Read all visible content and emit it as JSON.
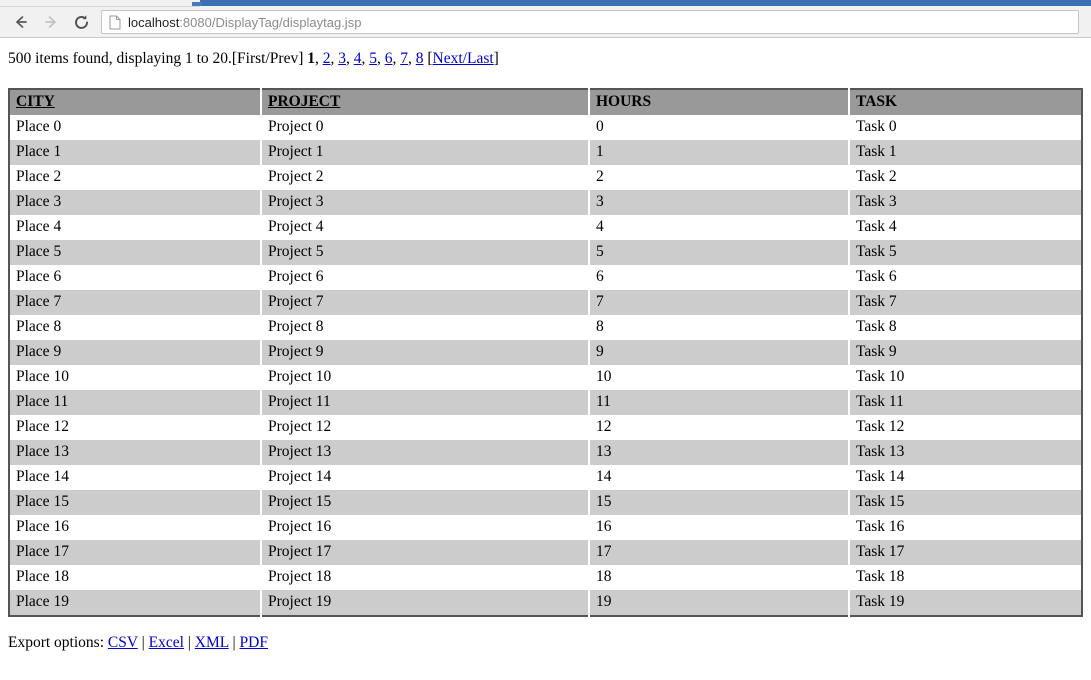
{
  "browser": {
    "back_label": "Back",
    "forward_label": "Forward",
    "reload_label": "Reload",
    "url_host": "localhost",
    "url_rest": ":8080/DisplayTag/displaytag.jsp",
    "url_full": "localhost:8080/DisplayTag/displaytag.jsp",
    "page_icon": "page-icon"
  },
  "pagination": {
    "summary": "500 items found, displaying 1 to 20.",
    "first_prev": "[First/Prev]",
    "current_page": "1",
    "comma": ", ",
    "pages": [
      "2",
      "3",
      "4",
      "5",
      "6",
      "7",
      "8"
    ],
    "next_last_open": "[",
    "next_label": "Next",
    "next_last_slash": "/",
    "last_label": "Last",
    "next_last_close": "]",
    "total_items": 500,
    "display_from": 1,
    "display_to": 20
  },
  "table": {
    "columns": [
      {
        "label": "CITY",
        "sortable": true
      },
      {
        "label": "PROJECT",
        "sortable": true
      },
      {
        "label": "HOURS",
        "sortable": false
      },
      {
        "label": "TASK",
        "sortable": false
      }
    ],
    "rows": [
      [
        "Place 0",
        "Project 0",
        "0",
        "Task 0"
      ],
      [
        "Place 1",
        "Project 1",
        "1",
        "Task 1"
      ],
      [
        "Place 2",
        "Project 2",
        "2",
        "Task 2"
      ],
      [
        "Place 3",
        "Project 3",
        "3",
        "Task 3"
      ],
      [
        "Place 4",
        "Project 4",
        "4",
        "Task 4"
      ],
      [
        "Place 5",
        "Project 5",
        "5",
        "Task 5"
      ],
      [
        "Place 6",
        "Project 6",
        "6",
        "Task 6"
      ],
      [
        "Place 7",
        "Project 7",
        "7",
        "Task 7"
      ],
      [
        "Place 8",
        "Project 8",
        "8",
        "Task 8"
      ],
      [
        "Place 9",
        "Project 9",
        "9",
        "Task 9"
      ],
      [
        "Place 10",
        "Project 10",
        "10",
        "Task 10"
      ],
      [
        "Place 11",
        "Project 11",
        "11",
        "Task 11"
      ],
      [
        "Place 12",
        "Project 12",
        "12",
        "Task 12"
      ],
      [
        "Place 13",
        "Project 13",
        "13",
        "Task 13"
      ],
      [
        "Place 14",
        "Project 14",
        "14",
        "Task 14"
      ],
      [
        "Place 15",
        "Project 15",
        "15",
        "Task 15"
      ],
      [
        "Place 16",
        "Project 16",
        "16",
        "Task 16"
      ],
      [
        "Place 17",
        "Project 17",
        "17",
        "Task 17"
      ],
      [
        "Place 18",
        "Project 18",
        "18",
        "Task 18"
      ],
      [
        "Place 19",
        "Project 19",
        "19",
        "Task 19"
      ]
    ]
  },
  "export": {
    "label": "Export options:",
    "separator": "|",
    "links": [
      "CSV",
      "Excel",
      "XML",
      "PDF"
    ]
  },
  "colors": {
    "header_bg": "#999999",
    "alt_row_bg": "#cccccc",
    "row_bg": "#ffffff",
    "table_border": "#555555",
    "link": "#0000cc",
    "tab_blue": "#3b6eb5",
    "chrome_bg": "#f1f1f1"
  }
}
